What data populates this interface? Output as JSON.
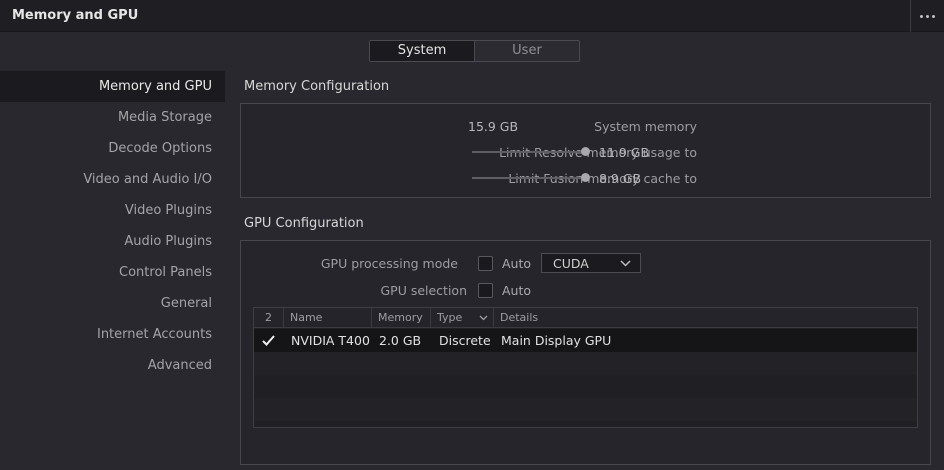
{
  "window": {
    "title": "Memory and GPU"
  },
  "tabs": [
    {
      "label": "System",
      "active": true
    },
    {
      "label": "User",
      "active": false
    }
  ],
  "sidebar": {
    "items": [
      {
        "label": "Memory and GPU",
        "active": true
      },
      {
        "label": "Media Storage"
      },
      {
        "label": "Decode Options"
      },
      {
        "label": "Video and Audio I/O"
      },
      {
        "label": "Video Plugins"
      },
      {
        "label": "Audio Plugins"
      },
      {
        "label": "Control Panels"
      },
      {
        "label": "General"
      },
      {
        "label": "Internet Accounts"
      },
      {
        "label": "Advanced"
      }
    ]
  },
  "memory": {
    "title": "Memory Configuration",
    "system_label": "System memory",
    "system_value": "15.9 GB",
    "resolve_label": "Limit Resolve memory usage to",
    "resolve_value": "11.9 GB",
    "resolve_level": 1.0,
    "fusion_label": "Limit Fusion memory cache to",
    "fusion_value": "8.9 GB",
    "fusion_level": 1.0
  },
  "gpu": {
    "title": "GPU Configuration",
    "mode_label": "GPU processing mode",
    "mode_auto_label": "Auto",
    "mode_auto_checked": false,
    "mode_value": "CUDA",
    "selection_label": "GPU selection",
    "selection_auto_label": "Auto",
    "selection_auto_checked": false,
    "table": {
      "columns": [
        "2",
        "Name",
        "Memory",
        "Type",
        "Details"
      ],
      "rows": [
        {
          "checked": true,
          "name": "NVIDIA T400",
          "memory": "2.0 GB",
          "type": "Discrete",
          "details": "Main Display GPU"
        }
      ]
    }
  },
  "colors": {
    "background": "#28282e",
    "panel": "#25252b",
    "selected": "#1b1b1f",
    "text": "#c8c8c8"
  },
  "icons": [
    "more-icon",
    "chevron-down-icon",
    "checkmark-icon"
  ]
}
